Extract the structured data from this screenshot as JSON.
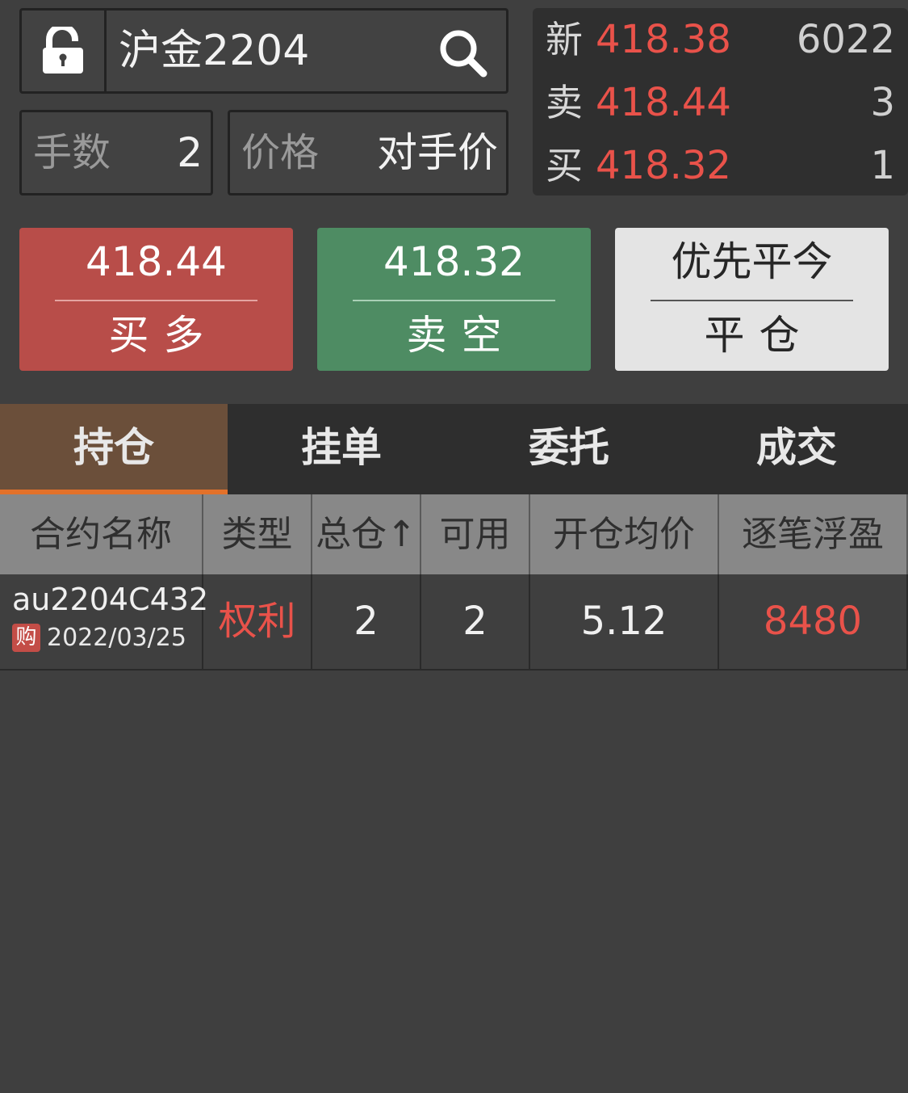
{
  "search": {
    "symbol": "沪金2204"
  },
  "order": {
    "qty_label": "手数",
    "qty_value": "2",
    "price_label": "价格",
    "price_value": "对手价"
  },
  "quote": {
    "rows": [
      {
        "label": "新",
        "price": "418.38",
        "volume": "6022"
      },
      {
        "label": "卖",
        "price": "418.44",
        "volume": "3"
      },
      {
        "label": "买",
        "price": "418.32",
        "volume": "1"
      }
    ]
  },
  "actions": {
    "buy": {
      "price": "418.44",
      "label": "买多"
    },
    "sell": {
      "price": "418.32",
      "label": "卖空"
    },
    "close": {
      "mode": "优先平今",
      "label": "平仓"
    }
  },
  "tabs": [
    {
      "label": "持仓",
      "active": true
    },
    {
      "label": "挂单",
      "active": false
    },
    {
      "label": "委托",
      "active": false
    },
    {
      "label": "成交",
      "active": false
    }
  ],
  "table": {
    "headers": [
      "合约名称",
      "类型",
      "总仓↑",
      "可用",
      "开仓均价",
      "逐笔浮盈"
    ],
    "rows": [
      {
        "contract": "au2204C432",
        "badge": "购",
        "date": "2022/03/25",
        "type": "权利",
        "total": "2",
        "available": "2",
        "avg_price": "5.12",
        "pnl": "8480"
      }
    ]
  },
  "colors": {
    "up_red": "#e9524a",
    "buy_button": "#b84d49",
    "sell_button": "#4e8c63",
    "tab_active": "#6b4f3a",
    "tab_active_underline": "#e3712a"
  },
  "icons": {
    "lock": "unlocked-padlock-icon",
    "search": "search-icon"
  }
}
